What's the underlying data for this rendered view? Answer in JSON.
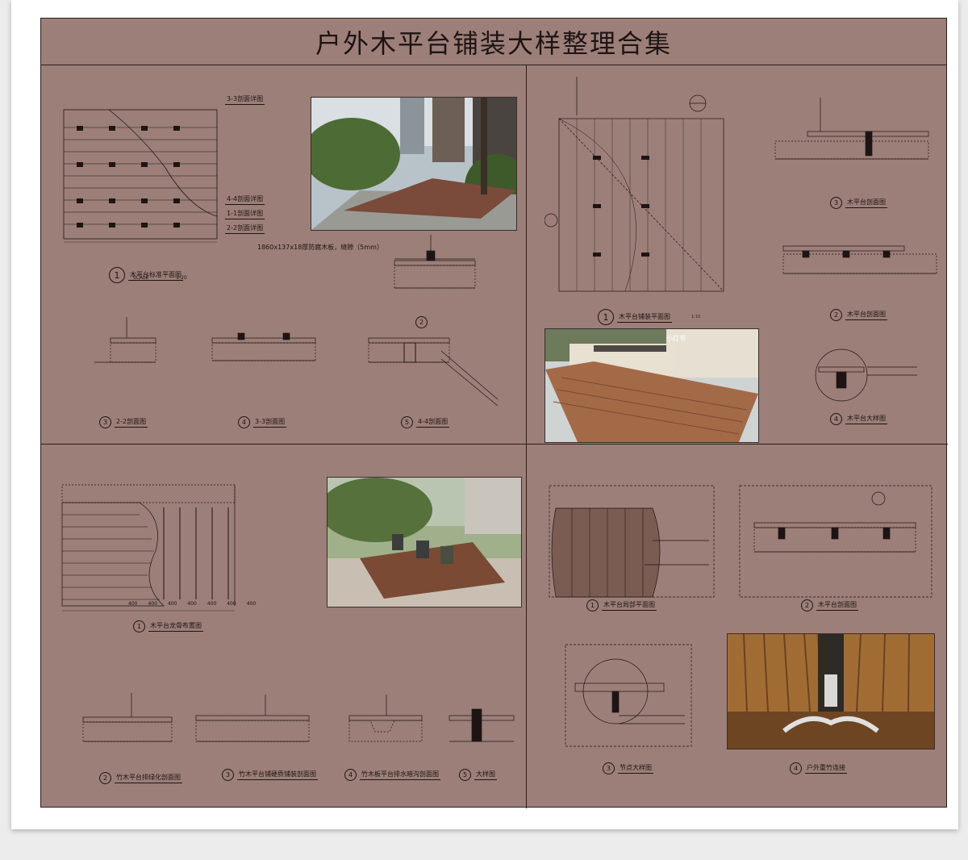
{
  "title": "户外木平台铺装大样整理合集",
  "colors": {
    "board": "#9c7f78",
    "line": "#2a1f1d",
    "page": "#ececec"
  },
  "panel_tl": {
    "plan_label": "木平台标准平面图",
    "plan_num": "1",
    "plan_scale": "SCALE",
    "plan_scale_val": "1:20",
    "note_dims": "1860x137x18厚防腐木板，缝隙（5mm）",
    "sections": [
      {
        "num": "3",
        "label": "2-2剖面图"
      },
      {
        "num": "4",
        "label": "3-3剖面图"
      },
      {
        "num": "5",
        "label": "4-4剖面图"
      }
    ],
    "detail_num": "2",
    "callouts": [
      "3-3剖面详图",
      "4-4剖面详图",
      "1-1剖面详图",
      "2-2剖面详图"
    ]
  },
  "panel_tr": {
    "plan_num": "1",
    "plan_label": "木平台铺装平面图",
    "plan_scale": "1:10",
    "sections": [
      {
        "num": "3",
        "label": "木平台剖面图"
      },
      {
        "num": "2",
        "label": "木平台剖面图"
      },
      {
        "num": "4",
        "label": "木平台大样图"
      }
    ],
    "photo_tag": "小红书"
  },
  "panel_bl": {
    "plan_num": "1",
    "plan_label": "木平台龙骨布置图",
    "dims": [
      "400",
      "400",
      "400",
      "400",
      "400",
      "400",
      "400"
    ],
    "sections": [
      {
        "num": "2",
        "label": "竹木平台排绿化剖面图"
      },
      {
        "num": "3",
        "label": "竹木平台铺硬质铺装剖面图"
      },
      {
        "num": "4",
        "label": "竹木板平台排水暗沟剖面图"
      },
      {
        "num": "5",
        "label": "大样图"
      }
    ]
  },
  "panel_br": {
    "sections": [
      {
        "num": "1",
        "label": "木平台局部平面图"
      },
      {
        "num": "2",
        "label": "木平台剖面图"
      },
      {
        "num": "3",
        "label": "节点大样图"
      },
      {
        "num": "4",
        "label": "户外重竹连接"
      }
    ]
  }
}
